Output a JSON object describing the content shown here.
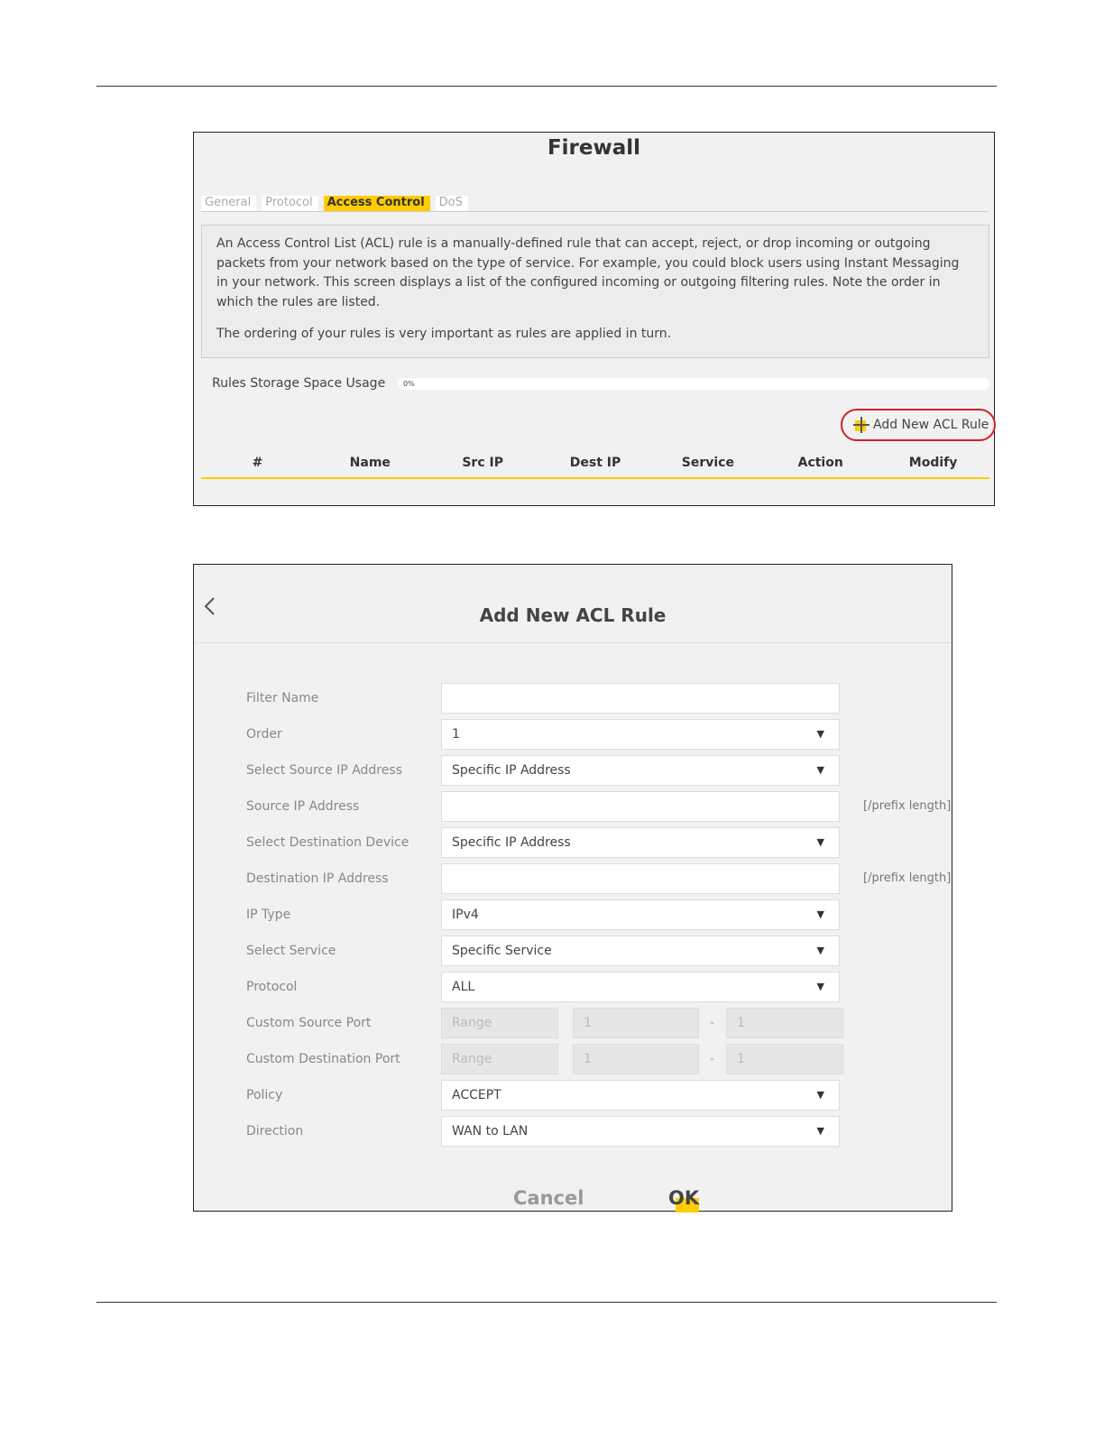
{
  "firewall": {
    "title": "Firewall",
    "tabs": [
      {
        "label": "General"
      },
      {
        "label": "Protocol"
      },
      {
        "label": "Access Control"
      },
      {
        "label": "DoS"
      }
    ],
    "description": [
      "An Access Control List (ACL) rule is a manually-defined rule that can accept, reject, or drop incoming or outgoing packets from your network based on the type of service. For example, you could block users using Instant Messaging in your network. This screen displays a list of the configured incoming or outgoing filtering rules. Note the order in which the rules are listed.",
      "The ordering of your rules is very important as rules are applied in turn."
    ],
    "storage_label": "Rules Storage Space Usage",
    "storage_percent": "0%",
    "storage_value": 0,
    "add_rule_label": "Add New ACL Rule",
    "columns": [
      "#",
      "Name",
      "Src IP",
      "Dest IP",
      "Service",
      "Action",
      "Modify"
    ]
  },
  "acl": {
    "title": "Add New ACL Rule",
    "fields": {
      "filter_name": {
        "label": "Filter Name",
        "value": ""
      },
      "order": {
        "label": "Order",
        "value": "1"
      },
      "select_source": {
        "label": "Select Source IP Address",
        "value": "Specific IP Address"
      },
      "source_ip": {
        "label": "Source IP Address",
        "value": "",
        "suffix": "[/prefix length]"
      },
      "select_destination": {
        "label": "Select Destination Device",
        "value": "Specific IP Address"
      },
      "destination_ip": {
        "label": "Destination IP Address",
        "value": "",
        "suffix": "[/prefix length]"
      },
      "ip_type": {
        "label": "IP Type",
        "value": "IPv4"
      },
      "select_service": {
        "label": "Select Service",
        "value": "Specific Service"
      },
      "protocol": {
        "label": "Protocol",
        "value": "ALL"
      },
      "custom_source_port": {
        "label": "Custom Source Port",
        "range": "Range",
        "start": "1",
        "dash": "-",
        "end": "1"
      },
      "custom_destination_port": {
        "label": "Custom Destination Port",
        "range": "Range",
        "start": "1",
        "dash": "-",
        "end": "1"
      },
      "policy": {
        "label": "Policy",
        "value": "ACCEPT"
      },
      "direction": {
        "label": "Direction",
        "value": "WAN to LAN"
      }
    },
    "caret": "▼",
    "cancel_label": "Cancel",
    "ok_label": "OK"
  },
  "colors": {
    "accent": "#ffcc00",
    "highlight_ring": "#d21f2a"
  }
}
